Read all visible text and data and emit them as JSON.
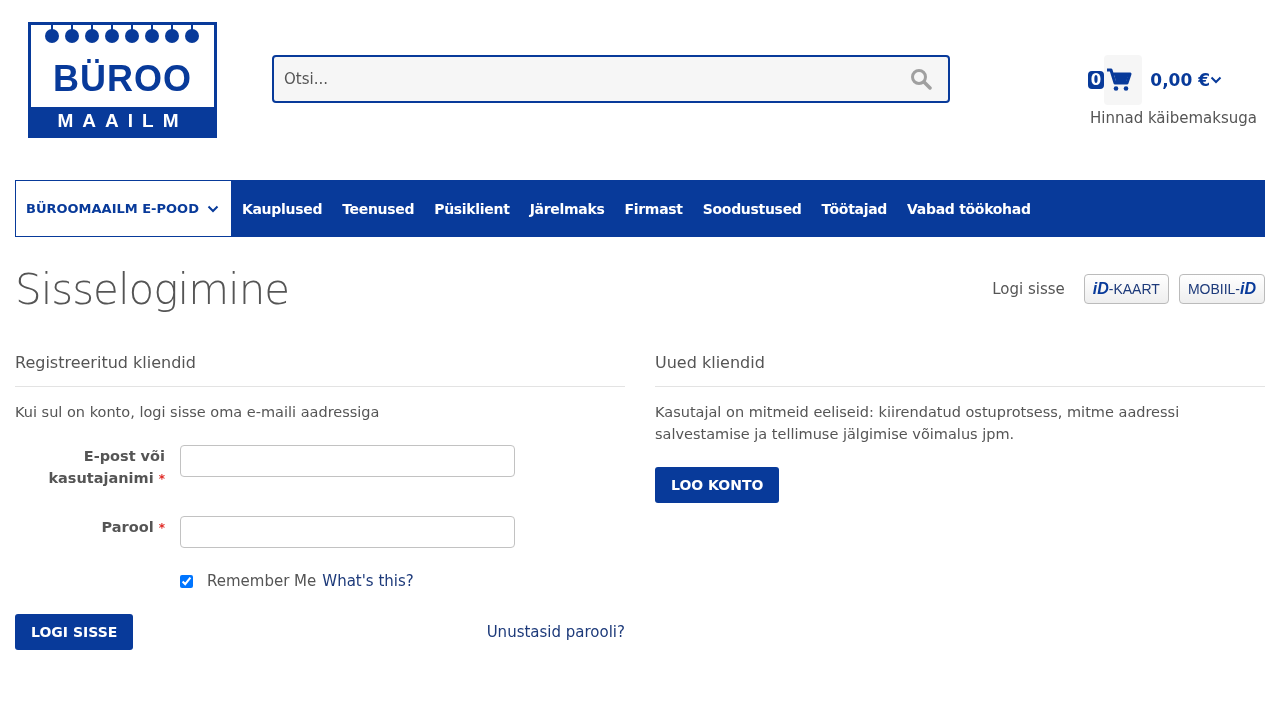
{
  "logo": {
    "line1": "BÜROO",
    "line2": "MAAILM"
  },
  "search": {
    "placeholder": "Otsi..."
  },
  "cart": {
    "count": "0",
    "total": "0,00 €",
    "note": "Hinnad käibemaksuga"
  },
  "nav": [
    {
      "label": "BÜROOMAAILM E-POOD",
      "kind": "dropdown"
    },
    {
      "label": "Kauplused",
      "kind": "link"
    },
    {
      "label": "Teenused",
      "kind": "link"
    },
    {
      "label": "Püsiklient",
      "kind": "link"
    },
    {
      "label": "Järelmaks",
      "kind": "link"
    },
    {
      "label": "Firmast",
      "kind": "link"
    },
    {
      "label": "Soodustused",
      "kind": "link"
    },
    {
      "label": "Töötajad",
      "kind": "link"
    },
    {
      "label": "Vabad töökohad",
      "kind": "link"
    }
  ],
  "page_title": "Sisselogimine",
  "id_login": {
    "label": "Logi sisse",
    "buttons": [
      {
        "kind": "prefix",
        "mark": "iD",
        "text": "-KAART"
      },
      {
        "kind": "suffix",
        "mark": "iD",
        "text": "MOBIIL-"
      }
    ]
  },
  "registered": {
    "heading": "Registreeritud kliendid",
    "intro": "Kui sul on konto, logi sisse oma e-maili aadressiga",
    "fields": [
      {
        "label": "E-post või kasutajanimi",
        "required_mark": "*"
      },
      {
        "label": "Parool",
        "required_mark": "*"
      }
    ],
    "remember": {
      "label": "Remember Me",
      "checked": true,
      "link": "What's this?"
    },
    "submit": "LOGI SISSE",
    "forgot": "Unustasid parooli?"
  },
  "new_customers": {
    "heading": "Uued kliendid",
    "text": "Kasutajal on mitmeid eeliseid: kiirendatud ostuprotsess, mitme aadressi salvestamise ja tellimuse jälgimise võimalus jpm.",
    "button": "LOO KONTO"
  }
}
